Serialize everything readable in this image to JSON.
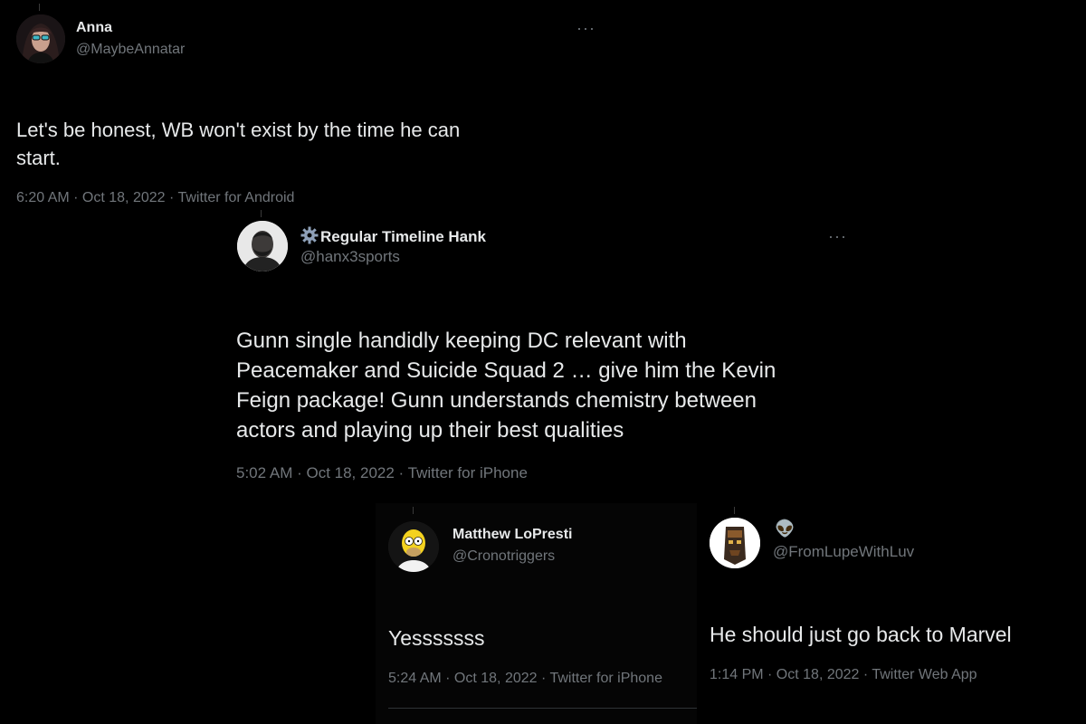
{
  "tweets": [
    {
      "name": "Anna",
      "handle": "@MaybeAnnatar",
      "text_lines": [
        "Let's be honest, WB won't exist by the time he can",
        "start."
      ],
      "meta": "6:20 AM · Oct 18, 2022 · Twitter for Android",
      "more_icon": "more-dots-icon"
    },
    {
      "name": "Regular Timeline Hank",
      "name_prefix_icon": "gear-icon",
      "handle": "@hanx3sports",
      "text_lines": [
        "Gunn single handidly keeping DC relevant with",
        "Peacemaker and Suicide Squad 2 … give him the Kevin",
        "Feign package! Gunn understands chemistry between",
        "actors and playing up their best qualities"
      ],
      "meta": "5:02 AM · Oct 18, 2022 · Twitter for iPhone",
      "more_icon": "more-dots-icon"
    },
    {
      "name": "Matthew LoPresti",
      "handle": "@Cronotriggers",
      "text_lines": [
        "Yesssssss"
      ],
      "meta": "5:24 AM · Oct 18, 2022 · Twitter for iPhone"
    },
    {
      "name": "👽",
      "handle": "@FromLupeWithLuv",
      "text_lines": [
        "He should just go back to Marvel"
      ],
      "meta": "1:14 PM · Oct 18, 2022 · Twitter Web App"
    }
  ],
  "colors": {
    "background": "#000000",
    "text_primary": "#e7e9ea",
    "text_secondary": "#71767b",
    "gear_fill": "#8ea0b8"
  }
}
